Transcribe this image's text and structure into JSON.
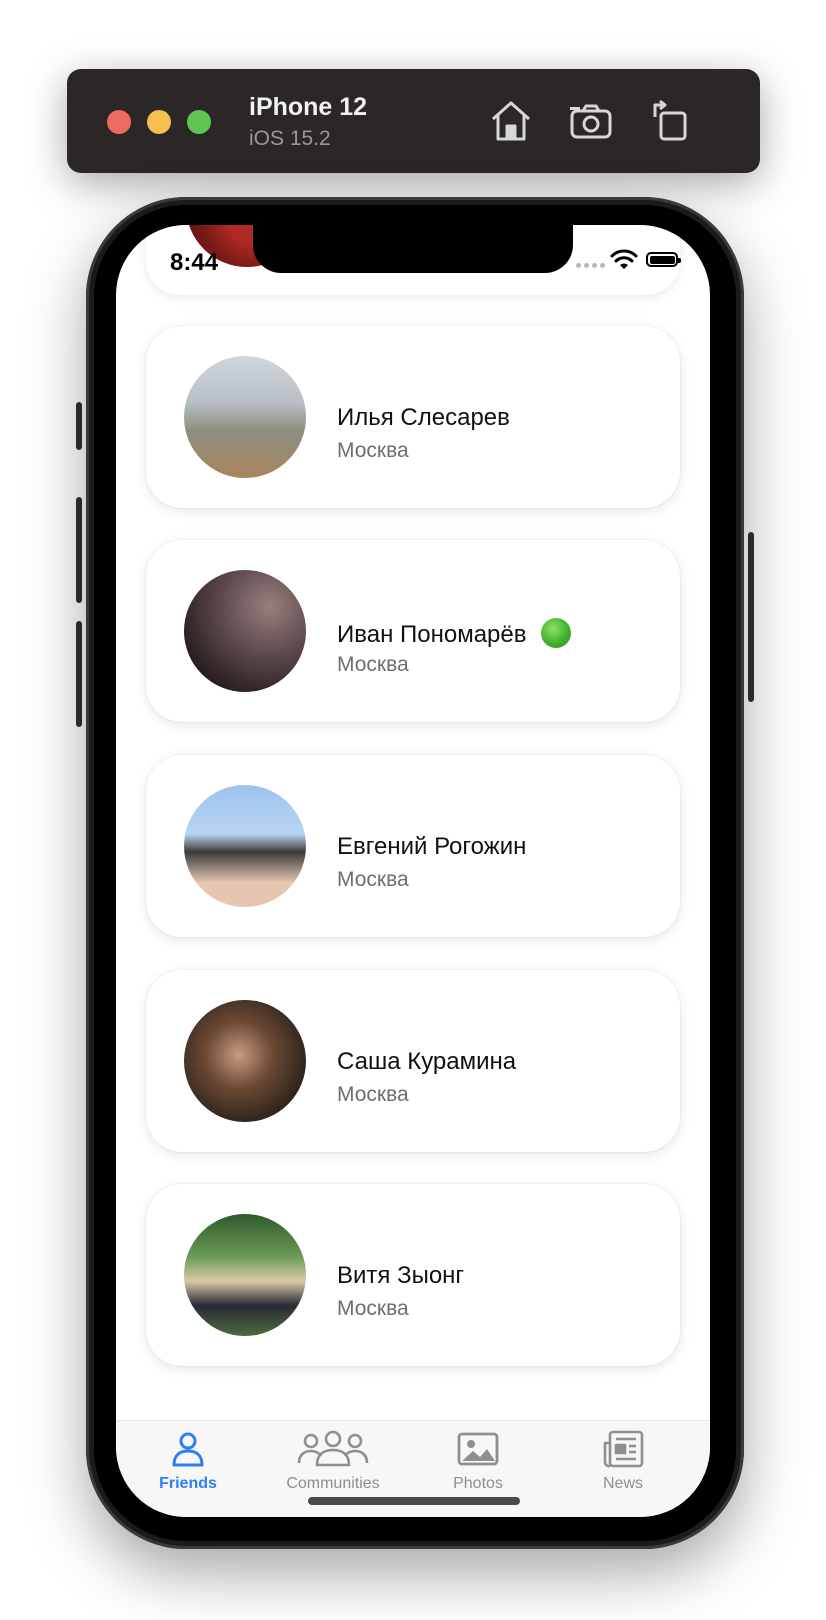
{
  "simulator": {
    "device": "iPhone 12",
    "os": "iOS 15.2",
    "buttons": [
      "home-icon",
      "screenshot-icon",
      "rotate-icon"
    ]
  },
  "status_bar": {
    "time": "8:44"
  },
  "friends": [
    {
      "name": "Илья Слесарев",
      "city": "Москва",
      "online": false
    },
    {
      "name": "Иван Пономарёв",
      "city": "Москва",
      "online": true
    },
    {
      "name": "Евгений Рогожин",
      "city": "Москва",
      "online": false
    },
    {
      "name": "Саша Курамина",
      "city": "Москва",
      "online": false
    },
    {
      "name": "Витя Зыонг",
      "city": "Москва",
      "online": false
    }
  ],
  "tabbar": {
    "tabs": [
      {
        "label": "Friends",
        "icon": "person-icon",
        "active": true
      },
      {
        "label": "Communities",
        "icon": "group-icon",
        "active": false
      },
      {
        "label": "Photos",
        "icon": "photo-icon",
        "active": false
      },
      {
        "label": "News",
        "icon": "newspaper-icon",
        "active": false
      }
    ]
  },
  "colors": {
    "accent": "#2f7df6",
    "inactive": "#8e8e93",
    "online": "#3fb32b",
    "sim_bar": "#2b2726"
  }
}
